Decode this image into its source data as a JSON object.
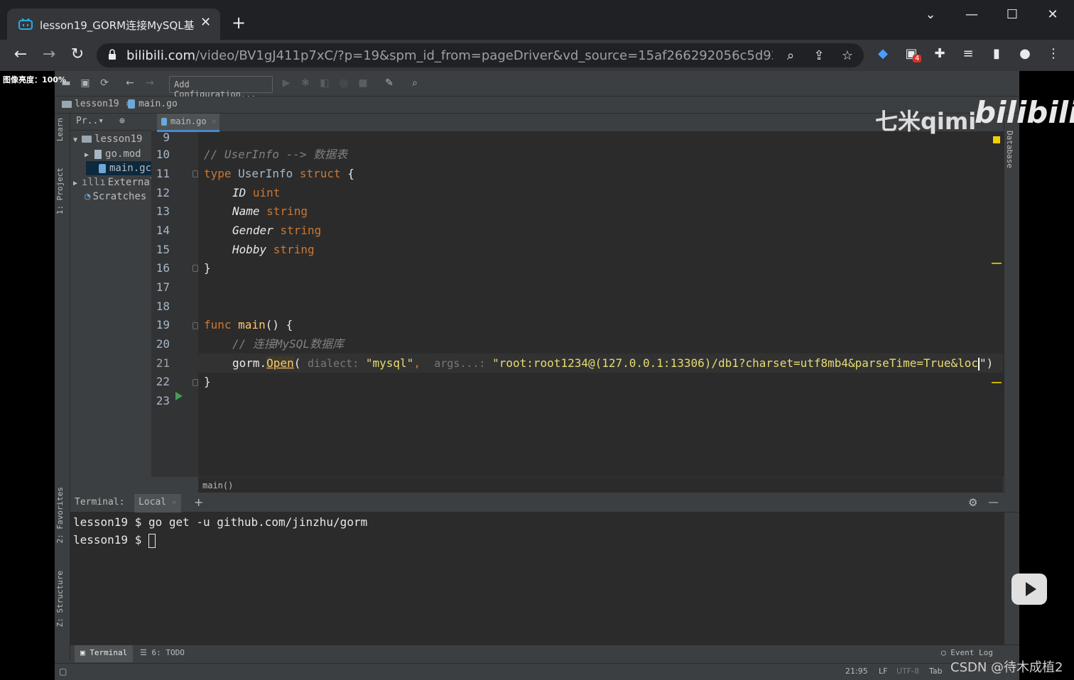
{
  "browser": {
    "tab_title": "lesson19_GORM连接MySQL基",
    "tab_close": "✕",
    "new_tab": "+",
    "url_host": "bilibili.com",
    "url_path": "/video/BV1gJ411p7xC/?p=19&spm_id_from=pageDriver&vd_source=15af266292056c5d92fb6a...",
    "extension_badge": "4"
  },
  "overlay": {
    "brightness": "图像亮度：100%"
  },
  "ide": {
    "toolbar": {
      "add_configuration": "Add Configuration..."
    },
    "breadcrumb": {
      "project": "lesson19",
      "file": "main.go"
    },
    "left_strip": {
      "learn": "Learn",
      "project": "1: Project",
      "favorites": "2: Favorites",
      "structure": "Z: Structure"
    },
    "right_strip": {
      "database": "Database"
    },
    "project_panel": {
      "header": "Pr..▾",
      "items": [
        {
          "label": "lesson19",
          "kind": "folder"
        },
        {
          "label": "go.mod",
          "kind": "mod"
        },
        {
          "label": "main.gc",
          "kind": "go"
        },
        {
          "label": "External",
          "kind": "lib"
        },
        {
          "label": "Scratches",
          "kind": "scratch"
        }
      ]
    },
    "editor_tab": "main.go",
    "line_numbers": [
      "9",
      "10",
      "11",
      "12",
      "13",
      "14",
      "15",
      "16",
      "17",
      "18",
      "19",
      "20",
      "21",
      "22",
      "23"
    ],
    "code": {
      "l10_comment": "// UserInfo --> 数据表",
      "l11_type": "type",
      "l11_name": " UserInfo ",
      "l11_struct": "struct",
      "l11_brace": " {",
      "l12_field": "ID",
      "l12_type": "uint",
      "l13_field": "Name",
      "l13_type": "string",
      "l14_field": "Gender",
      "l14_type": "string",
      "l15_field": "Hobby",
      "l15_type": "string",
      "l16": "}",
      "l19_func": "func",
      "l19_main": "main",
      "l19_rest": "() {",
      "l20_comment": "// 连接MySQL数据库",
      "l21_pkg": "gorm.",
      "l21_open": "Open",
      "l21_paren": "(",
      "l21_hint1": "dialect:",
      "l21_str1": "\"mysql\"",
      "l21_comma": ",",
      "l21_hint2": "args...:",
      "l21_str2": "\"root:root1234@(127.0.0.1:13306)/db1?charset=utf8mb4&parseTime=True&loc",
      "l21_end": "\")",
      "l22": "}"
    },
    "code_breadcrumb": "main()",
    "terminal": {
      "label": "Terminal:",
      "tab": "Local",
      "add": "+",
      "line1": "lesson19 $ go get -u github.com/jinzhu/gorm",
      "line2": "lesson19 $ "
    },
    "bottom_tabs": {
      "terminal": "Terminal",
      "todo": "6: TODO"
    },
    "status": {
      "event_log": "Event Log",
      "position": "21:95",
      "line_sep": "LF",
      "encoding": "UTF-8",
      "indent": "Tab"
    }
  },
  "watermark": {
    "qimi": "七米qimi",
    "bilibili": "bilibili"
  },
  "csdn": "CSDN @待木成植2"
}
